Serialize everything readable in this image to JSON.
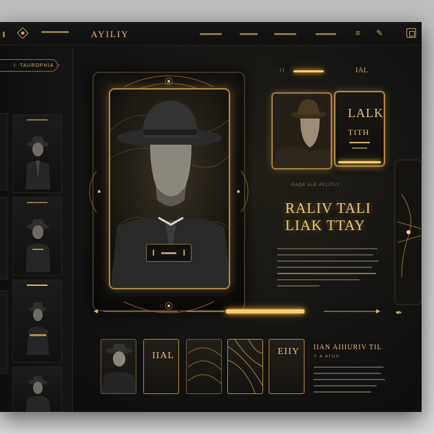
{
  "header": {
    "brand": "AYILIY",
    "nav": [
      "",
      "",
      "",
      ""
    ]
  },
  "sidebar": {
    "pill_label": "TAUROPHIA"
  },
  "hero": {
    "play_left": "I",
    "play_right": "I"
  },
  "right_panel": {
    "card_title": "LALK",
    "card_subtitle": "TITH",
    "small_caption": "IAL",
    "subtitle": "RAQE ALE AYLITLY",
    "headline": "RALIV TALI\nLIAK TTAY"
  },
  "bottom": {
    "thumb_text_1": "IIAL",
    "thumb_text_2": "EIIY",
    "title": "IIAN AIIIURIV TIL",
    "subtitle": "T A ATUO"
  },
  "colors": {
    "accent": "#e2b658",
    "background": "#121212",
    "frame": "#b88a38"
  }
}
